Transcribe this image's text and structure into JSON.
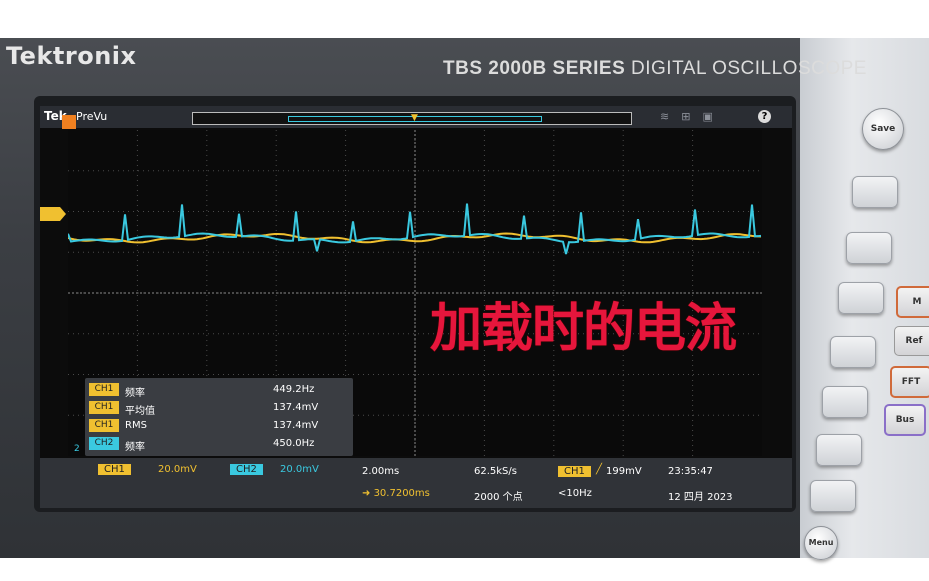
{
  "device": {
    "brand": "Tektronix",
    "model_series": "TBS 2000B SERIES",
    "model_desc": "DIGITAL OSCILLOSCOPE"
  },
  "screen": {
    "logo": "Tek",
    "mode": "PreVu"
  },
  "measurements": [
    {
      "channel": "CH1",
      "name": "频率",
      "value": "449.2Hz",
      "color": "#f0c030"
    },
    {
      "channel": "CH1",
      "name": "平均值",
      "value": "137.4mV",
      "color": "#f0c030"
    },
    {
      "channel": "CH1",
      "name": "RMS",
      "value": "137.4mV",
      "color": "#f0c030"
    },
    {
      "channel": "CH2",
      "name": "频率",
      "value": "450.0Hz",
      "color": "#3ac9e0"
    }
  ],
  "status": {
    "ch1_label": "CH1",
    "ch1_scale": "20.0mV",
    "ch2_label": "CH2",
    "ch2_scale": "20.0mV",
    "timebase": "2.00ms",
    "position": "30.7200ms",
    "sample_rate": "62.5kS/s",
    "record_length": "2000 个点",
    "trigger_source": "CH1",
    "trigger_level": "199mV",
    "trigger_freq": "<10Hz",
    "time": "23:35:47",
    "date": "12 四月 2023"
  },
  "ch2_ground_marker": "2",
  "caption": "加载时的电流",
  "side_buttons": {
    "save": "Save",
    "math": "M",
    "ref": "Ref",
    "fft": "FFT",
    "bus": "Bus",
    "menu": "Menu"
  },
  "colors": {
    "ch1": "#f0c030",
    "ch2": "#3ac9e0",
    "caption": "#e6163c"
  }
}
